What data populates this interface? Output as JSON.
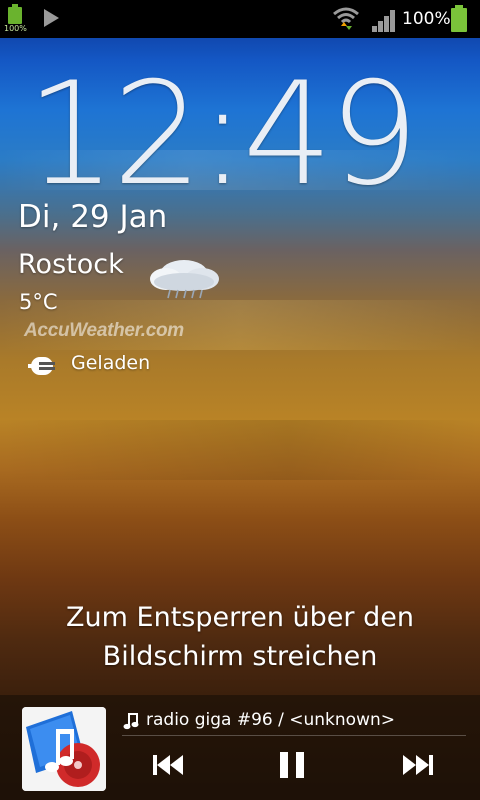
{
  "status_bar": {
    "small_battery_text": "100%",
    "battery_percent": "100%",
    "icons": [
      "battery-icon",
      "play-icon",
      "wifi-icon",
      "signal-icon",
      "battery-icon"
    ]
  },
  "lockscreen": {
    "time": "12:49",
    "date": "Di, 29 Jan",
    "weather": {
      "city": "Rostock",
      "temperature": "5°C",
      "provider": "AccuWeather.com",
      "condition_icon": "cloud-rain-icon"
    },
    "charging_status": "Geladen",
    "unlock_hint_line1": "Zum Entsperren über den",
    "unlock_hint_line2": "Bildschirm streichen"
  },
  "music_player": {
    "track": "radio giga #96 / <unknown>",
    "controls": [
      "previous-button",
      "pause-button",
      "next-button"
    ]
  },
  "colors": {
    "status_green": "#7bc43a",
    "wallpaper_top": "#0a2f8c",
    "wallpaper_mid": "#b98326",
    "wallpaper_bottom": "#2a170a"
  }
}
